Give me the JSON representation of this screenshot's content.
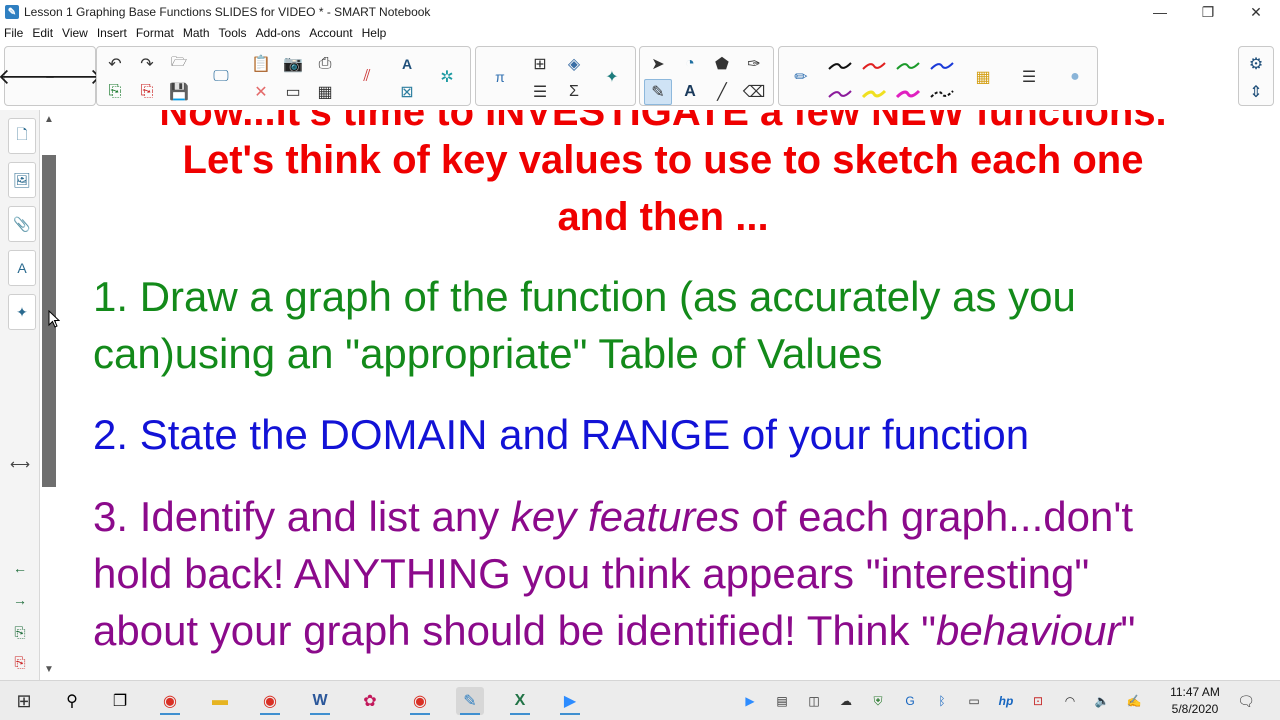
{
  "window": {
    "title": "Lesson 1 Graphing Base Functions SLIDES for VIDEO * - SMART Notebook",
    "app_icon": "smart-notebook-icon",
    "minimize": "—",
    "restore": "❐",
    "close": "✕"
  },
  "menu": [
    "File",
    "Edit",
    "View",
    "Insert",
    "Format",
    "Math",
    "Tools",
    "Add-ons",
    "Account",
    "Help"
  ],
  "canvas": {
    "partial_top_line": "Now...it's time to INVESTIGATE a few NEW functions.",
    "heading_line1": "Let's think of key values to use to sketch each one",
    "heading_line2": "and then ...",
    "item1_line1": "1. Draw a graph of the function (as accurately as you",
    "item1_line2": "can)using an \"appropriate\" Table of Values",
    "item2": "2. State the DOMAIN and RANGE of your function",
    "item3_a": "3. Identify and list any ",
    "item3_key": "key features",
    "item3_b": " of each graph...don't",
    "item3_line2": "hold back!  ANYTHING you think appears \"interesting\"",
    "item3_line3a": "about your graph should be identified! Think \"",
    "item3_behaviour": "behaviour",
    "item3_line3b": "\""
  },
  "colors": {
    "heading": "#ef0000",
    "item1": "#138a1a",
    "item2": "#1212d6",
    "item3": "#8b0a8b"
  },
  "taskbar": {
    "time": "11:47 AM",
    "date": "5/8/2020"
  }
}
